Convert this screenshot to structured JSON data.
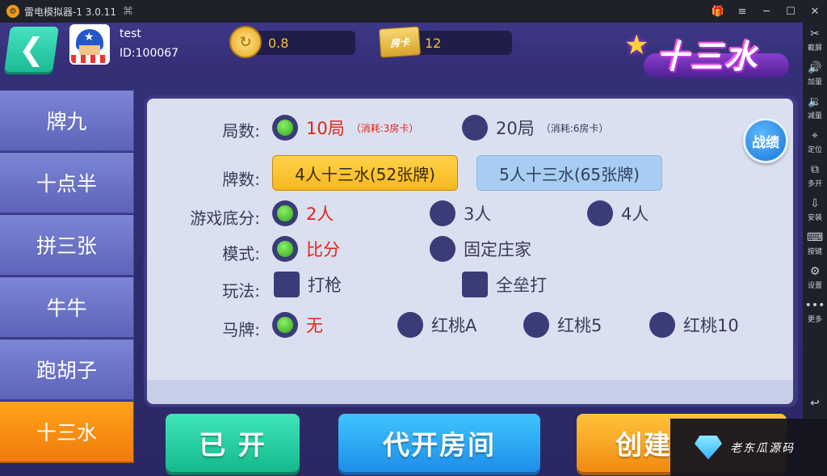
{
  "window": {
    "title": "雷电模拟器-1 3.0.11",
    "logo_glyph": "⚙",
    "gamepad_icon": "gamepad-icon"
  },
  "window_controls": [
    "gift-icon",
    "menu-icon",
    "minimize-icon",
    "maximize-icon",
    "close-icon"
  ],
  "right_toolbar": [
    {
      "icon": "✂",
      "label": "截屏"
    },
    {
      "icon": "🔊",
      "label": "加量"
    },
    {
      "icon": "🔉",
      "label": "减量"
    },
    {
      "icon": "⌖",
      "label": "定位"
    },
    {
      "icon": "⧉",
      "label": "多开"
    },
    {
      "icon": "⇩",
      "label": "安装"
    },
    {
      "icon": "⌨",
      "label": "按键"
    },
    {
      "icon": "⚙",
      "label": "设置"
    },
    {
      "icon": "•••",
      "label": "更多"
    }
  ],
  "back_arrow": "↩",
  "user": {
    "name": "test",
    "id": "ID:100067"
  },
  "coins": {
    "value": "0.8"
  },
  "room_cards": {
    "icon_text": "房卡",
    "value": "12"
  },
  "logo_text": "十三水",
  "sidebar": [
    "牌九",
    "十点半",
    "拼三张",
    "牛牛",
    "跑胡子",
    "十三水"
  ],
  "settings": {
    "rounds": {
      "label": "局数:",
      "options": [
        {
          "text": "10局",
          "cost": "（消耗:3房卡）",
          "selected": true
        },
        {
          "text": "20局",
          "cost": "（消耗:6房卡）",
          "selected": false
        }
      ]
    },
    "cards": {
      "label": "牌数:",
      "options": [
        {
          "text": "4人十三水(52张牌)",
          "selected": true
        },
        {
          "text": "5人十三水(65张牌)",
          "selected": false
        }
      ]
    },
    "base_score": {
      "label": "游戏底分:",
      "options": [
        {
          "text": "2人",
          "selected": true
        },
        {
          "text": "3人",
          "selected": false
        },
        {
          "text": "4人",
          "selected": false
        }
      ]
    },
    "mode": {
      "label": "模式:",
      "options": [
        {
          "text": "比分",
          "selected": true
        },
        {
          "text": "固定庄家",
          "selected": false
        }
      ]
    },
    "play": {
      "label": "玩法:",
      "options": [
        {
          "text": "打枪",
          "checked": false
        },
        {
          "text": "全垒打",
          "checked": false
        }
      ]
    },
    "horse_card": {
      "label": "马牌:",
      "options": [
        {
          "text": "无",
          "selected": true
        },
        {
          "text": "红桃A",
          "selected": false
        },
        {
          "text": "红桃5",
          "selected": false
        },
        {
          "text": "红桃10",
          "selected": false
        }
      ]
    }
  },
  "record_button": "战绩",
  "buttons": {
    "opened": "已 开",
    "proxy": "代开房间",
    "create": "创建"
  },
  "watermark": "老东瓜源码",
  "colors": {
    "selected_text": "#e02418",
    "active_tab": "#f07b0b",
    "panel": "#dbe0f0"
  }
}
